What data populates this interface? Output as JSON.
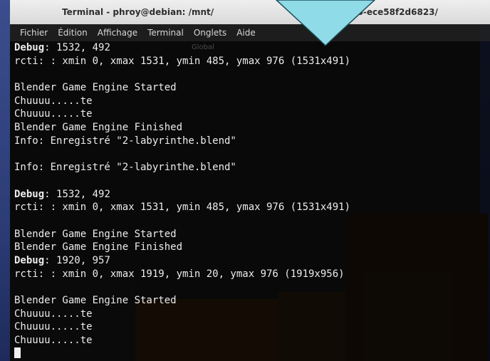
{
  "window": {
    "title": "Terminal - phroy@debian: /mnt/...-4354-af66-ece58f2d6823/",
    "title_left": "Terminal - phroy@debian: /mnt/",
    "title_right": "3-4354-af66-ece58f2d6823/"
  },
  "menu": [
    "Fichier",
    "Édition",
    "Affichage",
    "Terminal",
    "Onglets",
    "Aide"
  ],
  "ghost_toolbar": [
    "Global"
  ],
  "terminal_lines": [
    {
      "bold": "Debug",
      "text": ": 1532, 492"
    },
    {
      "text": "rcti: : xmin 0, xmax 1531, ymin 485, ymax 976 (1531x491)"
    },
    {
      "text": ""
    },
    {
      "text": "Blender Game Engine Started"
    },
    {
      "text": "Chuuuu.....te"
    },
    {
      "text": "Chuuuu.....te"
    },
    {
      "text": "Blender Game Engine Finished"
    },
    {
      "text": "Info: Enregistré \"2-labyrinthe.blend\""
    },
    {
      "text": ""
    },
    {
      "text": "Info: Enregistré \"2-labyrinthe.blend\""
    },
    {
      "text": ""
    },
    {
      "bold": "Debug",
      "text": ": 1532, 492"
    },
    {
      "text": "rcti: : xmin 0, xmax 1531, ymin 485, ymax 976 (1531x491)"
    },
    {
      "text": ""
    },
    {
      "text": "Blender Game Engine Started"
    },
    {
      "text": "Blender Game Engine Finished"
    },
    {
      "bold": "Debug",
      "text": ": 1920, 957"
    },
    {
      "text": "rcti: : xmin 0, xmax 1919, ymin 20, ymax 976 (1919x956)"
    },
    {
      "text": ""
    },
    {
      "text": "Blender Game Engine Started"
    },
    {
      "text": "Chuuuu.....te"
    },
    {
      "text": "Chuuuu.....te"
    },
    {
      "text": "Chuuuu.....te"
    }
  ],
  "colors": {
    "pointer": "#8fdbe8",
    "terminal_text": "#ececec"
  }
}
